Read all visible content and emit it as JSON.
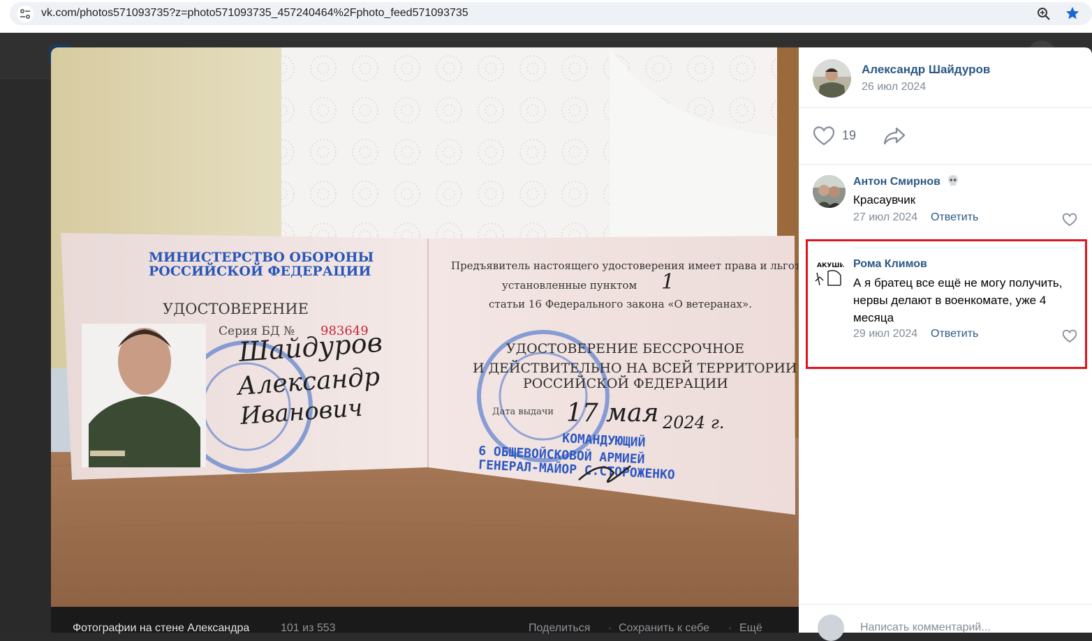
{
  "browser": {
    "url": "vk.com/photos571093735?z=photo571093735_457240464%2Fphoto_feed571093735"
  },
  "photo_viewer": {
    "album_title": "Фотографии на стене Александра",
    "counter": "101 из 553",
    "actions": [
      "Поделиться",
      "Сохранить к себе",
      "Ещё"
    ],
    "photo_text": {
      "left_org": "МИНИСТЕРСТВО ОБОРОНЫ\nРОССИЙСКОЙ ФЕДЕРАЦИИ",
      "doc_title": "УДОСТОВЕРЕНИЕ",
      "series": "Серия БД №",
      "number": "983649",
      "surname": "Шайдуров",
      "name": "Александр",
      "patronymic": "Иванович",
      "right_line1": "Предъявитель настоящего удостоверения имеет права и льготы,",
      "right_line2": "установленные пунктом",
      "right_point": "1",
      "right_line3": "статьи 16 Федерального закона «О ветеранах».",
      "validity1": "УДОСТОВЕРЕНИЕ БЕССРОЧНОЕ",
      "validity2": "И ДЕЙСТВИТЕЛЬНО НА ВСЕЙ ТЕРРИТОРИИ",
      "validity3": "РОССИЙСКОЙ ФЕДЕРАЦИИ",
      "issue_label": "Дата выдачи",
      "issue_date": "17 мая",
      "issue_year": "2024 г.",
      "commander1": "КОМАНДУЮЩИЙ",
      "commander2": "6 ОБЩЕВОЙСКОВОЙ АРМИЕЙ",
      "commander3": "ГЕНЕРАЛ-МАЙОР С.СТОРОЖЕНКО"
    }
  },
  "post": {
    "author_name": "Александр Шайдуров",
    "date": "26 июл 2024",
    "likes": "19"
  },
  "comments": [
    {
      "author": "Антон Смирнов",
      "text": "Красаувчик",
      "date": "27 июл 2024",
      "reply_label": "Ответить"
    },
    {
      "author": "Рома Климов",
      "text": "А я братец все ещё не могу получить, нервы делают в военкомате, уже 4 месяца",
      "date": "29 июл 2024",
      "reply_label": "Ответить",
      "avatar_text": "АКУШИ"
    }
  ],
  "comment_input": {
    "placeholder": "Написать комментарий..."
  },
  "colors": {
    "link": "#2a5885",
    "highlight": "#e0141e"
  }
}
